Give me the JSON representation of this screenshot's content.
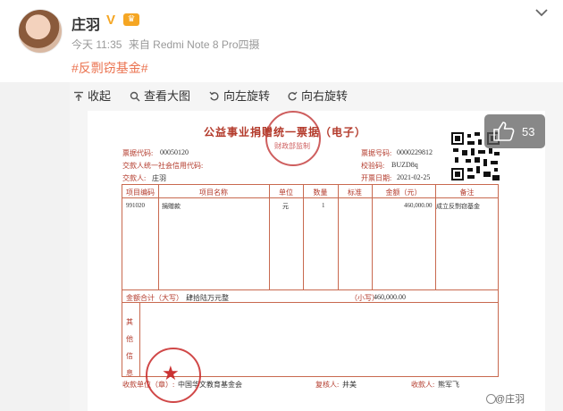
{
  "post": {
    "username": "庄羽",
    "verified_badge": "V",
    "meta_time": "今天 11:35",
    "meta_source": "来自 Redmi Note 8 Pro四摄",
    "topic": "#反剽窃基金#"
  },
  "toolbar": {
    "collapse_label": "收起",
    "view_large_label": "查看大图",
    "rotate_left_label": "向左旋转",
    "rotate_right_label": "向右旋转"
  },
  "receipt": {
    "title": "公益事业捐赠统一票据（电子）",
    "seal_top_text": "财政部监制",
    "receipt_code_label": "票据代码:",
    "receipt_code": "00050120",
    "payer_credit_label": "交款人统一社会信用代码:",
    "payer_label": "交款人:",
    "payer": "庄羽",
    "receipt_number_label": "票据号码:",
    "receipt_number": "0000229812",
    "check_code_label": "校验码:",
    "check_code": "BUZD8q",
    "issue_date_label": "开票日期:",
    "issue_date": "2021-02-25",
    "table_headers": [
      "项目编码",
      "项目名称",
      "单位",
      "数量",
      "标准",
      "金额（元）",
      "备注"
    ],
    "row": {
      "code": "991020",
      "name": "捐赠款",
      "unit": "元",
      "quantity": "1",
      "standard": "",
      "amount": "460,000.00",
      "remark": "成立反剽窃基金"
    },
    "total_label": "金额合计（大写）",
    "total_words": "肆拾陆万元整",
    "total_small_label": "（小写）",
    "total_small": "460,000.00",
    "other_info_label": "其他信息",
    "payee_unit_label": "收款单位（章）:",
    "payee_unit": "中国华文教育基金会",
    "reviewer_label": "复核人:",
    "reviewer": "井美",
    "payee_label": "收款人:",
    "payee": "熊军飞"
  },
  "like": {
    "count": "53"
  },
  "watermark": {
    "text": "@庄羽"
  },
  "icons": [
    "verified-icon",
    "crown-icon",
    "chevron-down-icon",
    "collapse-icon",
    "search-icon",
    "rotate-left-icon",
    "rotate-right-icon",
    "thumbs-up-icon",
    "qr-code-icon",
    "seal-icon"
  ]
}
